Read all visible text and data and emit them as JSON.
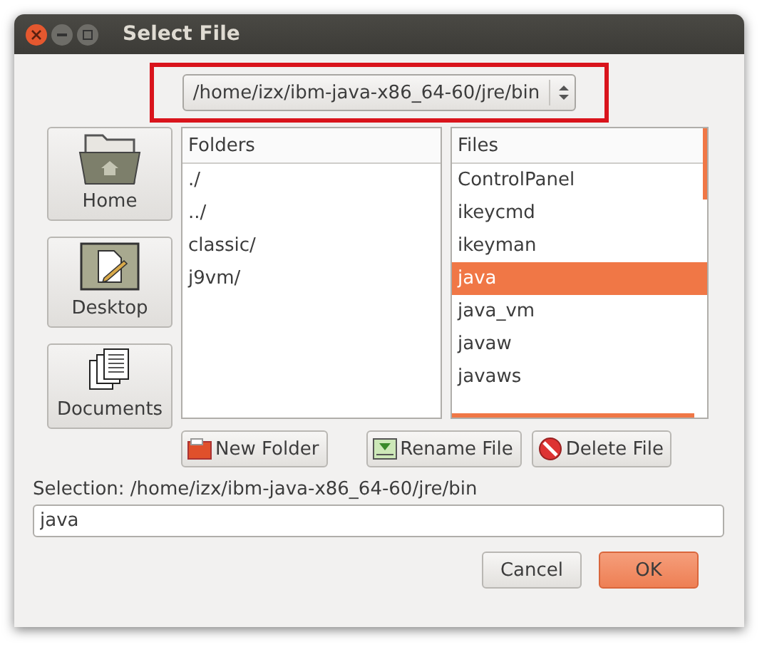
{
  "window": {
    "title": "Select File"
  },
  "path_combo": {
    "value": "/home/izx/ibm-java-x86_64-60/jre/bin"
  },
  "places": [
    {
      "label": "Home",
      "kind": "home"
    },
    {
      "label": "Desktop",
      "kind": "desktop"
    },
    {
      "label": "Documents",
      "kind": "documents"
    }
  ],
  "folders": {
    "header": "Folders",
    "items": [
      {
        "label": "./",
        "selected": false
      },
      {
        "label": "../",
        "selected": false
      },
      {
        "label": "classic/",
        "selected": false
      },
      {
        "label": "j9vm/",
        "selected": false
      }
    ]
  },
  "files": {
    "header": "Files",
    "items": [
      {
        "label": "ControlPanel",
        "selected": false
      },
      {
        "label": "ikeycmd",
        "selected": false
      },
      {
        "label": "ikeyman",
        "selected": false
      },
      {
        "label": "java",
        "selected": true
      },
      {
        "label": "java_vm",
        "selected": false
      },
      {
        "label": "javaw",
        "selected": false
      },
      {
        "label": "javaws",
        "selected": false
      }
    ]
  },
  "file_buttons": [
    {
      "label": "New Folder",
      "kind": "new"
    },
    {
      "label": "Rename File",
      "kind": "rename"
    },
    {
      "label": "Delete File",
      "kind": "delete"
    }
  ],
  "selection": {
    "label": "Selection: /home/izx/ibm-java-x86_64-60/jre/bin",
    "value": "java"
  },
  "buttons": [
    {
      "label": "Cancel",
      "kind": "cancel"
    },
    {
      "label": "OK",
      "kind": "ok"
    }
  ]
}
